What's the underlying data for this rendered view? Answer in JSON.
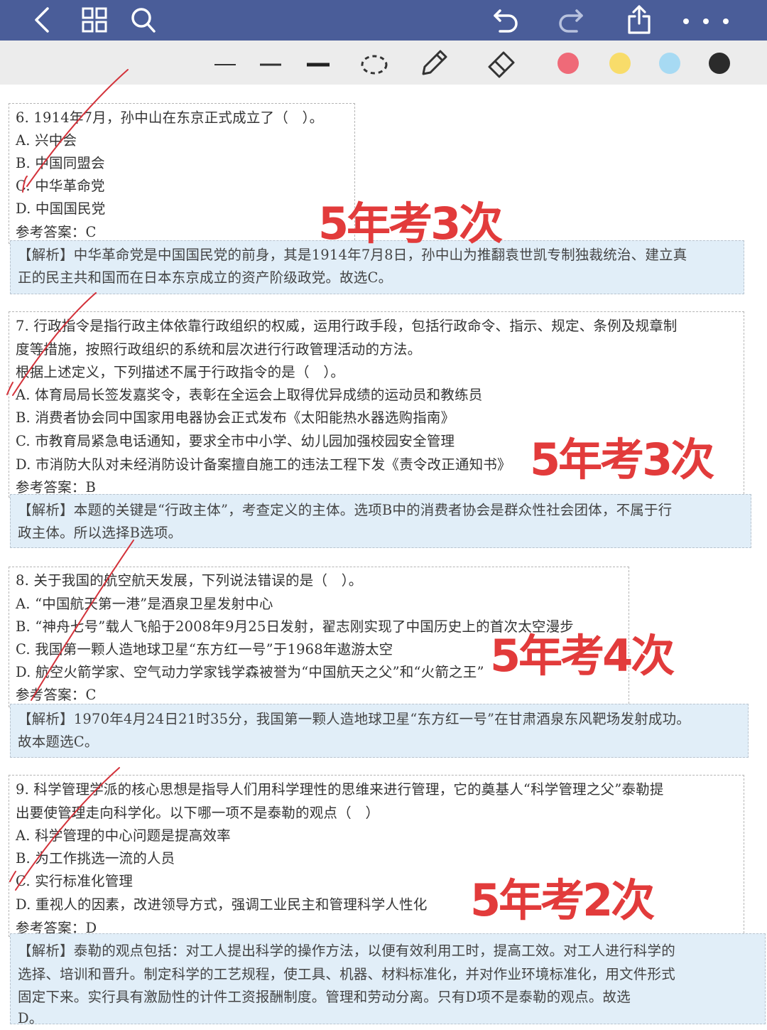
{
  "colors": {
    "topbar": "#4a5d99",
    "toolbar": "#ececec",
    "swatch_red": "#ef6a78",
    "swatch_yellow": "#f8dc6a",
    "swatch_blue": "#a7daf3",
    "swatch_black": "#2b2b2b",
    "stamp_red": "#e23b3b",
    "analysis_bg": "#e1eef8"
  },
  "icons": {
    "back": "chevron-left-icon",
    "grid": "grid-icon",
    "search": "search-icon",
    "undo": "undo-icon",
    "redo": "redo-icon",
    "share": "share-icon",
    "more": "more-icon"
  },
  "questions": [
    {
      "lines": [
        "6. 1914年7月，孙中山在东京正式成立了（　）。",
        "A. 兴中会",
        "B. 中国同盟会",
        "C. 中华革命党",
        "D. 中国国民党",
        "参考答案：C"
      ],
      "analysis": [
        "【解析】中华革命党是中国国民党的前身，其是1914年7月8日，孙中山为推翻袁世凯专制独裁统治、建立真",
        "正的民主共和国而在日本东京成立的资产阶级政党。故选C。"
      ],
      "stamp": "5年考3次"
    },
    {
      "lines": [
        "7. 行政指令是指行政主体依靠行政组织的权威，运用行政手段，包括行政命令、指示、规定、条例及规章制",
        "度等措施，按照行政组织的系统和层次进行行政管理活动的方法。",
        "根据上述定义，下列描述不属于行政指令的是（　）。",
        "A. 体育局局长签发嘉奖令，表彰在全运会上取得优异成绩的运动员和教练员",
        "B. 消费者协会同中国家用电器协会正式发布《太阳能热水器选购指南》",
        "C. 市教育局紧急电话通知，要求全市中小学、幼儿园加强校园安全管理",
        "D. 市消防大队对未经消防设计备案擅自施工的违法工程下发《责令改正通知书》",
        "参考答案：B"
      ],
      "analysis": [
        "【解析】本题的关键是“行政主体”，考查定义的主体。选项B中的消费者协会是群众性社会团体，不属于行",
        "政主体。所以选择B选项。"
      ],
      "stamp": "5年考3次"
    },
    {
      "lines": [
        "8. 关于我国的航空航天发展，下列说法错误的是（　）。",
        "A. “中国航天第一港”是酒泉卫星发射中心",
        "B. “神舟七号”载人飞船于2008年9月25日发射，翟志刚实现了中国历史上的首次太空漫步",
        "C. 我国第一颗人造地球卫星“东方红一号”于1968年遨游太空",
        "D. 航空火箭学家、空气动力学家钱学森被誉为“中国航天之父”和“火箭之王”",
        "参考答案：C"
      ],
      "analysis": [
        "【解析】1970年4月24日21时35分，我国第一颗人造地球卫星“东方红一号”在甘肃酒泉东风靶场发射成功。",
        "故本题选C。"
      ],
      "stamp": "5年考4次"
    },
    {
      "lines": [
        "9. 科学管理学派的核心思想是指导人们用科学理性的思维来进行管理，它的奠基人“科学管理之父”泰勒提",
        "出要使管理走向科学化。以下哪一项不是泰勒的观点（　）",
        "A. 科学管理的中心问题是提高效率",
        "B. 为工作挑选一流的人员",
        "C. 实行标准化管理",
        "D. 重视人的因素，改进领导方式，强调工业民主和管理科学人性化",
        "参考答案：D"
      ],
      "analysis": [
        "【解析】泰勒的观点包括：对工人提出科学的操作方法，以便有效利用工时，提高工效。对工人进行科学的",
        "选择、培训和晋升。制定科学的工艺规程，使工具、机器、材料标准化，并对作业环境标准化，用文件形式",
        "固定下来。实行具有激励性的计件工资报酬制度。管理和劳动分离。只有D项不是泰勒的观点。故选",
        "D。"
      ],
      "stamp": "5年考2次"
    }
  ]
}
